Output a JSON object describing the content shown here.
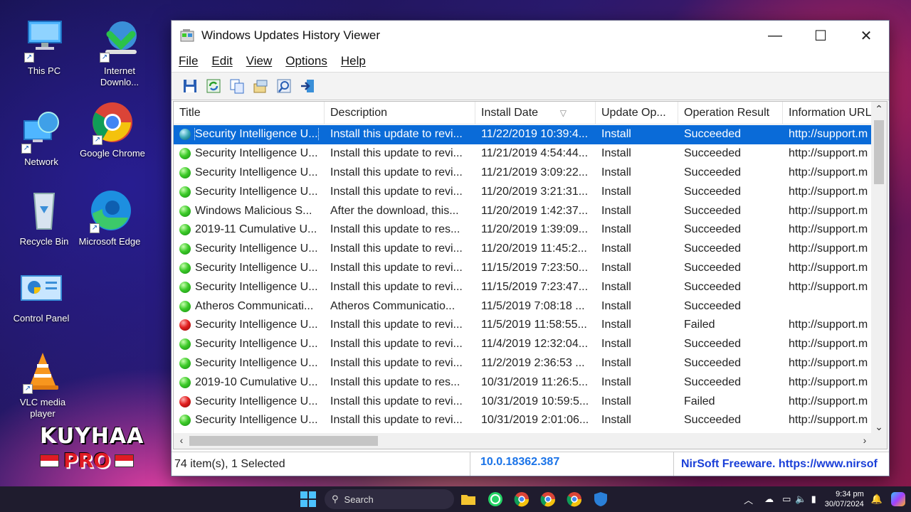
{
  "desktop": {
    "icons": [
      {
        "label": "This PC"
      },
      {
        "label": "Internet Downlo..."
      },
      {
        "label": "Network"
      },
      {
        "label": "Google Chrome"
      },
      {
        "label": "Recycle Bin"
      },
      {
        "label": "Microsoft Edge"
      },
      {
        "label": "Control Panel"
      },
      {
        "label": "VLC media player"
      }
    ],
    "logo": {
      "line1": "KUYHAA",
      "line2": "PRO"
    }
  },
  "window": {
    "title": "Windows Updates History Viewer",
    "controls": {
      "minimize": "—",
      "maximize": "☐",
      "close": "✕"
    },
    "menu": [
      "File",
      "Edit",
      "View",
      "Options",
      "Help"
    ],
    "toolbar": [
      "save-icon",
      "refresh-icon",
      "copy-icon",
      "properties-icon",
      "find-icon",
      "exit-icon"
    ],
    "columns": [
      "Title",
      "Description",
      "Install Date",
      "Update Op...",
      "Operation Result",
      "Information URL"
    ],
    "rows": [
      {
        "status": "selected",
        "title": "Security Intelligence U...",
        "description": "Install this update to revi...",
        "date": "11/22/2019 10:39:4...",
        "op": "Install",
        "result": "Succeeded",
        "url": "http://support.m"
      },
      {
        "status": "ok",
        "title": "Security Intelligence U...",
        "description": "Install this update to revi...",
        "date": "11/21/2019 4:54:44...",
        "op": "Install",
        "result": "Succeeded",
        "url": "http://support.m"
      },
      {
        "status": "ok",
        "title": "Security Intelligence U...",
        "description": "Install this update to revi...",
        "date": "11/21/2019 3:09:22...",
        "op": "Install",
        "result": "Succeeded",
        "url": "http://support.m"
      },
      {
        "status": "ok",
        "title": "Security Intelligence U...",
        "description": "Install this update to revi...",
        "date": "11/20/2019 3:21:31...",
        "op": "Install",
        "result": "Succeeded",
        "url": "http://support.m"
      },
      {
        "status": "ok",
        "title": "Windows Malicious S...",
        "description": "After the download, this...",
        "date": "11/20/2019 1:42:37...",
        "op": "Install",
        "result": "Succeeded",
        "url": "http://support.m"
      },
      {
        "status": "ok",
        "title": "2019-11 Cumulative U...",
        "description": "Install this update to res...",
        "date": "11/20/2019 1:39:09...",
        "op": "Install",
        "result": "Succeeded",
        "url": "http://support.m"
      },
      {
        "status": "ok",
        "title": "Security Intelligence U...",
        "description": "Install this update to revi...",
        "date": "11/20/2019 11:45:2...",
        "op": "Install",
        "result": "Succeeded",
        "url": "http://support.m"
      },
      {
        "status": "ok",
        "title": "Security Intelligence U...",
        "description": "Install this update to revi...",
        "date": "11/15/2019 7:23:50...",
        "op": "Install",
        "result": "Succeeded",
        "url": "http://support.m"
      },
      {
        "status": "ok",
        "title": "Security Intelligence U...",
        "description": "Install this update to revi...",
        "date": "11/15/2019 7:23:47...",
        "op": "Install",
        "result": "Succeeded",
        "url": "http://support.m"
      },
      {
        "status": "ok",
        "title": "Atheros Communicati...",
        "description": "Atheros Communicatio...",
        "date": "11/5/2019 7:08:18 ...",
        "op": "Install",
        "result": "Succeeded",
        "url": ""
      },
      {
        "status": "fail",
        "title": "Security Intelligence U...",
        "description": "Install this update to revi...",
        "date": "11/5/2019 11:58:55...",
        "op": "Install",
        "result": "Failed",
        "url": "http://support.m"
      },
      {
        "status": "ok",
        "title": "Security Intelligence U...",
        "description": "Install this update to revi...",
        "date": "11/4/2019 12:32:04...",
        "op": "Install",
        "result": "Succeeded",
        "url": "http://support.m"
      },
      {
        "status": "ok",
        "title": "Security Intelligence U...",
        "description": "Install this update to revi...",
        "date": "11/2/2019 2:36:53 ...",
        "op": "Install",
        "result": "Succeeded",
        "url": "http://support.m"
      },
      {
        "status": "ok",
        "title": "2019-10 Cumulative U...",
        "description": "Install this update to res...",
        "date": "10/31/2019 11:26:5...",
        "op": "Install",
        "result": "Succeeded",
        "url": "http://support.m"
      },
      {
        "status": "fail",
        "title": "Security Intelligence U...",
        "description": "Install this update to revi...",
        "date": "10/31/2019 10:59:5...",
        "op": "Install",
        "result": "Failed",
        "url": "http://support.m"
      },
      {
        "status": "ok",
        "title": "Security Intelligence U...",
        "description": "Install this update to revi...",
        "date": "10/31/2019 2:01:06...",
        "op": "Install",
        "result": "Succeeded",
        "url": "http://support.m"
      }
    ],
    "status": {
      "items": "74 item(s), 1 Selected",
      "version": "10.0.18362.387",
      "credit": "NirSoft Freeware. https://www.nirsof"
    }
  },
  "taskbar": {
    "search_placeholder": "Search",
    "time": "9:34 pm",
    "date": "30/07/2024"
  }
}
